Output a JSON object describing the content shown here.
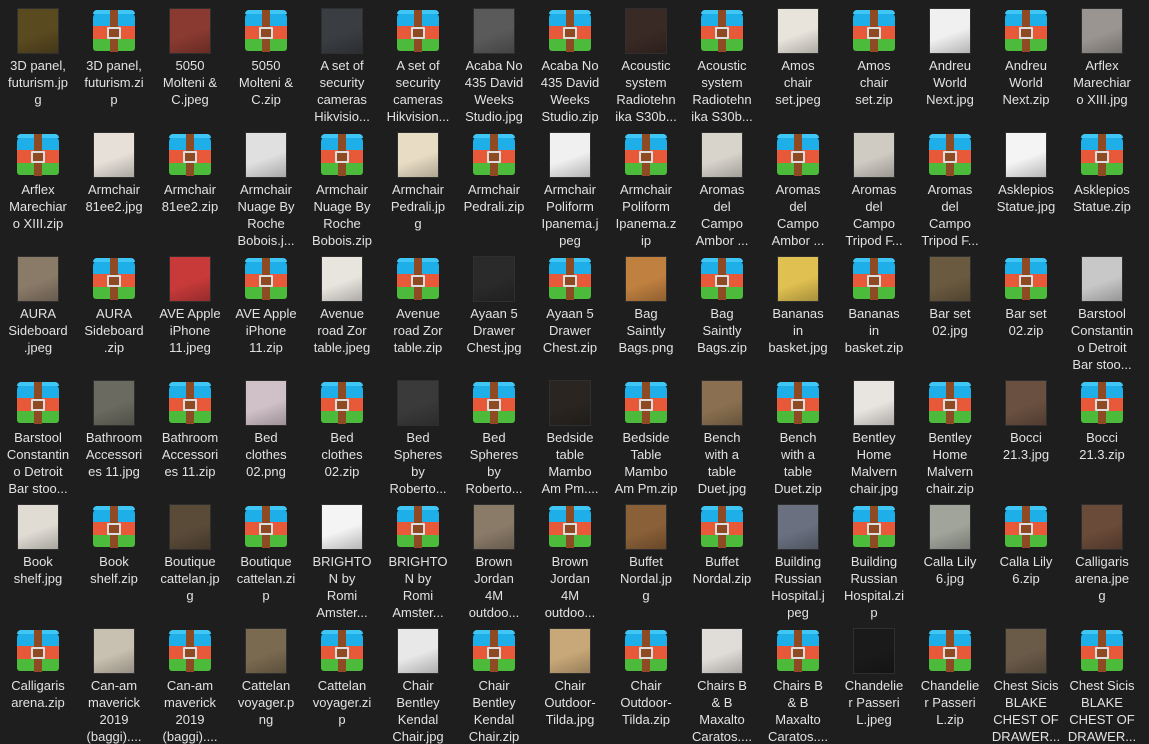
{
  "colors": {
    "background": "#1e1e1e",
    "text": "#e2e2e2"
  },
  "items": [
    {
      "type": "image",
      "color": "#5a4a20",
      "lines": [
        "3D panel,",
        "futurism.jp",
        "g"
      ]
    },
    {
      "type": "zip",
      "lines": [
        "3D panel,",
        "futurism.zi",
        "p"
      ]
    },
    {
      "type": "image",
      "color": "#8a3a30",
      "lines": [
        "5050",
        "Molteni &",
        "C.jpeg"
      ]
    },
    {
      "type": "zip",
      "lines": [
        "5050",
        "Molteni &",
        "C.zip"
      ]
    },
    {
      "type": "image",
      "color": "#3a3d42",
      "lines": [
        "A set of",
        "security",
        "cameras",
        "Hikvisio..."
      ]
    },
    {
      "type": "zip",
      "lines": [
        "A set of",
        "security",
        "cameras",
        "Hikvision..."
      ]
    },
    {
      "type": "image",
      "color": "#5a5a5a",
      "lines": [
        "Acaba No",
        "435 David",
        "Weeks",
        "Studio.jpg"
      ]
    },
    {
      "type": "zip",
      "lines": [
        "Acaba No",
        "435 David",
        "Weeks",
        "Studio.zip"
      ]
    },
    {
      "type": "image",
      "color": "#3a2a25",
      "lines": [
        "Acoustic",
        "system",
        "Radiotehn",
        "ika S30b..."
      ]
    },
    {
      "type": "zip",
      "lines": [
        "Acoustic",
        "system",
        "Radiotehn",
        "ika S30b..."
      ]
    },
    {
      "type": "image",
      "color": "#e8e4dc",
      "lines": [
        "Amos",
        "chair",
        "set.jpeg"
      ]
    },
    {
      "type": "zip",
      "lines": [
        "Amos",
        "chair",
        "set.zip"
      ]
    },
    {
      "type": "image",
      "color": "#f0f0f0",
      "lines": [
        "Andreu",
        "World",
        "Next.jpg"
      ]
    },
    {
      "type": "zip",
      "lines": [
        "Andreu",
        "World",
        "Next.zip"
      ]
    },
    {
      "type": "image",
      "color": "#9a9590",
      "lines": [
        "Arflex",
        "Marechiar",
        "o XIII.jpg"
      ]
    },
    {
      "type": "zip",
      "lines": [
        "Arflex",
        "Marechiar",
        "o XIII.zip"
      ]
    },
    {
      "type": "image",
      "color": "#e6e0d8",
      "lines": [
        "Armchair",
        "81ee2.jpg"
      ]
    },
    {
      "type": "zip",
      "lines": [
        "Armchair",
        "81ee2.zip"
      ]
    },
    {
      "type": "image",
      "color": "#e0e0e0",
      "lines": [
        "Armchair",
        "Nuage By",
        "Roche",
        "Bobois.j..."
      ]
    },
    {
      "type": "zip",
      "lines": [
        "Armchair",
        "Nuage By",
        "Roche",
        "Bobois.zip"
      ]
    },
    {
      "type": "image",
      "color": "#e8dcc4",
      "lines": [
        "Armchair",
        "Pedrali.jp",
        "g"
      ]
    },
    {
      "type": "zip",
      "lines": [
        "Armchair",
        "Pedrali.zip"
      ]
    },
    {
      "type": "image",
      "color": "#f0f0f0",
      "lines": [
        "Armchair",
        "Poliform",
        "Ipanema.j",
        "peg"
      ]
    },
    {
      "type": "zip",
      "lines": [
        "Armchair",
        "Poliform",
        "Ipanema.z",
        "ip"
      ]
    },
    {
      "type": "image",
      "color": "#d8d4cc",
      "lines": [
        "Aromas",
        "del",
        "Campo",
        "Ambor ..."
      ]
    },
    {
      "type": "zip",
      "lines": [
        "Aromas",
        "del",
        "Campo",
        "Ambor ..."
      ]
    },
    {
      "type": "image",
      "color": "#cfcac2",
      "lines": [
        "Aromas",
        "del",
        "Campo",
        "Tripod F..."
      ]
    },
    {
      "type": "zip",
      "lines": [
        "Aromas",
        "del",
        "Campo",
        "Tripod F..."
      ]
    },
    {
      "type": "image",
      "color": "#f4f4f4",
      "lines": [
        "Asklepios",
        "Statue.jpg"
      ]
    },
    {
      "type": "zip",
      "lines": [
        "Asklepios",
        "Statue.zip"
      ]
    },
    {
      "type": "image",
      "color": "#8a7a68",
      "lines": [
        "AURA",
        "Sideboard",
        ".jpeg"
      ]
    },
    {
      "type": "zip",
      "lines": [
        "AURA",
        "Sideboard",
        ".zip"
      ]
    },
    {
      "type": "image",
      "color": "#c83a3a",
      "lines": [
        "AVE Apple",
        "iPhone",
        "11.jpeg"
      ]
    },
    {
      "type": "zip",
      "lines": [
        "AVE Apple",
        "iPhone",
        "11.zip"
      ]
    },
    {
      "type": "image",
      "color": "#e8e4de",
      "lines": [
        "Avenue",
        "road Zor",
        "table.jpeg"
      ]
    },
    {
      "type": "zip",
      "lines": [
        "Avenue",
        "road Zor",
        "table.zip"
      ]
    },
    {
      "type": "image",
      "color": "#2a2a2a",
      "lines": [
        "Ayaan 5",
        "Drawer",
        "Chest.jpg"
      ]
    },
    {
      "type": "zip",
      "lines": [
        "Ayaan 5",
        "Drawer",
        "Chest.zip"
      ]
    },
    {
      "type": "image",
      "color": "#c08040",
      "lines": [
        "Bag",
        "Saintly",
        "Bags.png"
      ]
    },
    {
      "type": "zip",
      "lines": [
        "Bag",
        "Saintly",
        "Bags.zip"
      ]
    },
    {
      "type": "image",
      "color": "#e0c050",
      "lines": [
        "Bananas",
        "in",
        "basket.jpg"
      ]
    },
    {
      "type": "zip",
      "lines": [
        "Bananas",
        "in",
        "basket.zip"
      ]
    },
    {
      "type": "image",
      "color": "#6a5a40",
      "lines": [
        "Bar set",
        "02.jpg"
      ]
    },
    {
      "type": "zip",
      "lines": [
        "Bar set",
        "02.zip"
      ]
    },
    {
      "type": "image",
      "color": "#c8c8c8",
      "lines": [
        "Barstool",
        "Constantin",
        "o Detroit",
        "Bar stoo..."
      ]
    },
    {
      "type": "zip",
      "lines": [
        "Barstool",
        "Constantin",
        "o Detroit",
        "Bar stoo..."
      ]
    },
    {
      "type": "image",
      "color": "#6a6a60",
      "lines": [
        "Bathroom",
        "Accessori",
        "es 11.jpg"
      ]
    },
    {
      "type": "zip",
      "lines": [
        "Bathroom",
        "Accessori",
        "es 11.zip"
      ]
    },
    {
      "type": "image",
      "color": "#d0c0c8",
      "lines": [
        "Bed",
        "clothes",
        "02.png"
      ]
    },
    {
      "type": "zip",
      "lines": [
        "Bed",
        "clothes",
        "02.zip"
      ]
    },
    {
      "type": "image",
      "color": "#3a3a3a",
      "lines": [
        "Bed",
        "Spheres",
        "by",
        "Roberto..."
      ]
    },
    {
      "type": "zip",
      "lines": [
        "Bed",
        "Spheres",
        "by",
        "Roberto..."
      ]
    },
    {
      "type": "image",
      "color": "#2a2520",
      "lines": [
        "Bedside",
        "table",
        "Mambo",
        "Am Pm...."
      ]
    },
    {
      "type": "zip",
      "lines": [
        "Bedside",
        "Table",
        "Mambo",
        "Am Pm.zip"
      ]
    },
    {
      "type": "image",
      "color": "#8a7050",
      "lines": [
        "Bench",
        "with a",
        "table",
        "Duet.jpg"
      ]
    },
    {
      "type": "zip",
      "lines": [
        "Bench",
        "with a",
        "table",
        "Duet.zip"
      ]
    },
    {
      "type": "image",
      "color": "#e8e4e0",
      "lines": [
        "Bentley",
        "Home",
        "Malvern",
        "chair.jpg"
      ]
    },
    {
      "type": "zip",
      "lines": [
        "Bentley",
        "Home",
        "Malvern",
        "chair.zip"
      ]
    },
    {
      "type": "image",
      "color": "#6a5040",
      "lines": [
        "Bocci",
        "21.3.jpg"
      ]
    },
    {
      "type": "zip",
      "lines": [
        "Bocci",
        "21.3.zip"
      ]
    },
    {
      "type": "image",
      "color": "#e0dcd4",
      "lines": [
        "Book",
        "shelf.jpg"
      ]
    },
    {
      "type": "zip",
      "lines": [
        "Book",
        "shelf.zip"
      ]
    },
    {
      "type": "image",
      "color": "#5a4a38",
      "lines": [
        "Boutique",
        "cattelan.jp",
        "g"
      ]
    },
    {
      "type": "zip",
      "lines": [
        "Boutique",
        "cattelan.zi",
        "p"
      ]
    },
    {
      "type": "image",
      "color": "#f4f4f4",
      "lines": [
        "BRIGHTO",
        "N by",
        "Romi",
        "Amster..."
      ]
    },
    {
      "type": "zip",
      "lines": [
        "BRIGHTO",
        "N by",
        "Romi",
        "Amster..."
      ]
    },
    {
      "type": "image",
      "color": "#8a7a68",
      "lines": [
        "Brown",
        "Jordan",
        "4M",
        "outdoo..."
      ]
    },
    {
      "type": "zip",
      "lines": [
        "Brown",
        "Jordan",
        "4M",
        "outdoo..."
      ]
    },
    {
      "type": "image",
      "color": "#8a6038",
      "lines": [
        "Buffet",
        "Nordal.jp",
        "g"
      ]
    },
    {
      "type": "zip",
      "lines": [
        "Buffet",
        "Nordal.zip"
      ]
    },
    {
      "type": "image",
      "color": "#6a7080",
      "lines": [
        "Building",
        "Russian",
        "Hospital.j",
        "peg"
      ]
    },
    {
      "type": "zip",
      "lines": [
        "Building",
        "Russian",
        "Hospital.zi",
        "p"
      ]
    },
    {
      "type": "image",
      "color": "#a0a49a",
      "lines": [
        "Calla Lily",
        "6.jpg"
      ]
    },
    {
      "type": "zip",
      "lines": [
        "Calla Lily",
        "6.zip"
      ]
    },
    {
      "type": "image",
      "color": "#6a4a38",
      "lines": [
        "Calligaris",
        "arena.jpe",
        "g"
      ]
    },
    {
      "type": "zip",
      "lines": [
        "Calligaris",
        "arena.zip"
      ]
    },
    {
      "type": "image",
      "color": "#c8c0b0",
      "lines": [
        "Can-am",
        "maverick",
        "2019",
        "(baggi)...."
      ]
    },
    {
      "type": "zip",
      "lines": [
        "Can-am",
        "maverick",
        "2019",
        "(baggi)...."
      ]
    },
    {
      "type": "image",
      "color": "#7a6a50",
      "lines": [
        "Cattelan",
        "voyager.p",
        "ng"
      ]
    },
    {
      "type": "zip",
      "lines": [
        "Cattelan",
        "voyager.zi",
        "p"
      ]
    },
    {
      "type": "image",
      "color": "#e8e8e8",
      "lines": [
        "Chair",
        "Bentley",
        "Kendal",
        "Chair.jpg"
      ]
    },
    {
      "type": "zip",
      "lines": [
        "Chair",
        "Bentley",
        "Kendal",
        "Chair.zip"
      ]
    },
    {
      "type": "image",
      "color": "#c8a878",
      "lines": [
        "Chair",
        "Outdoor-",
        "Tilda.jpg"
      ]
    },
    {
      "type": "zip",
      "lines": [
        "Chair",
        "Outdoor-",
        "Tilda.zip"
      ]
    },
    {
      "type": "image",
      "color": "#e0dcd8",
      "lines": [
        "Chairs B",
        "& B",
        "Maxalto",
        "Caratos...."
      ]
    },
    {
      "type": "zip",
      "lines": [
        "Chairs B",
        "& B",
        "Maxalto",
        "Caratos...."
      ]
    },
    {
      "type": "image",
      "color": "#1a1a1a",
      "lines": [
        "Chandelie",
        "r Passeri",
        "L.jpeg"
      ]
    },
    {
      "type": "zip",
      "lines": [
        "Chandelie",
        "r Passeri",
        "L.zip"
      ]
    },
    {
      "type": "image",
      "color": "#6a5a48",
      "lines": [
        "Chest Sicis",
        "BLAKE",
        "CHEST OF",
        "DRAWER..."
      ]
    },
    {
      "type": "zip",
      "lines": [
        "Chest Sicis",
        "BLAKE",
        "CHEST OF",
        "DRAWER..."
      ]
    }
  ]
}
